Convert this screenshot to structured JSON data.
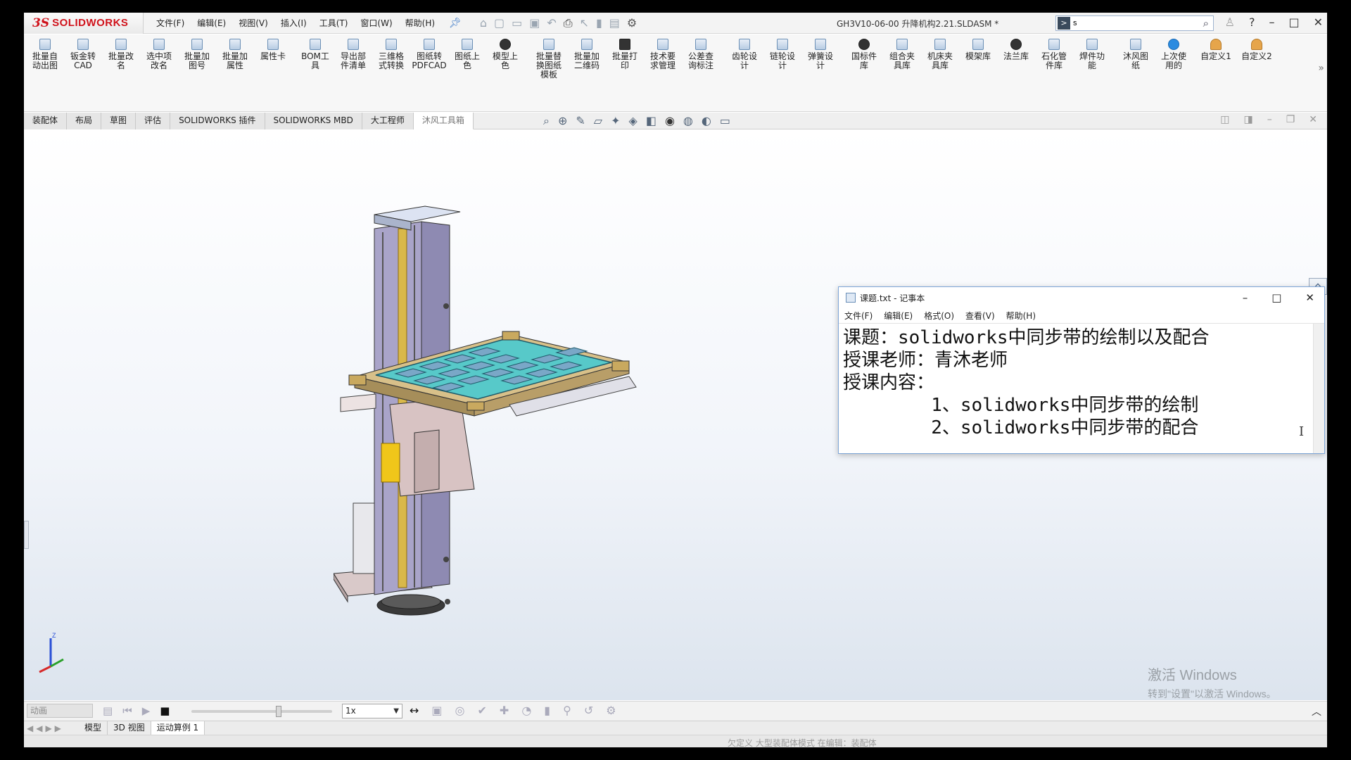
{
  "app": {
    "logo_ds": "3S",
    "logo_text": "SOLIDWORKS",
    "menu": [
      "文件(F)",
      "编辑(E)",
      "视图(V)",
      "插入(I)",
      "工具(T)",
      "窗口(W)",
      "帮助(H)"
    ],
    "document_title": "GH3V10-06-00 升降机构2.21.SLDASM *",
    "search_value": "s"
  },
  "toolbar": {
    "items": [
      {
        "label": "批量自\n动出图",
        "icon": "batch-drawing-icon"
      },
      {
        "label": "钣金转\nCAD",
        "icon": "sheetmetal-cad-icon"
      },
      {
        "label": "批量改\n名",
        "icon": "batch-rename-icon"
      },
      {
        "label": "选中项\n改名",
        "icon": "rename-selected-icon"
      },
      {
        "label": "批量加\n图号",
        "icon": "batch-number-icon"
      },
      {
        "label": "批量加\n属性",
        "icon": "batch-property-icon"
      },
      {
        "label": "属性卡",
        "icon": "property-card-icon"
      },
      {
        "label": "BOM工\n具",
        "icon": "bom-icon"
      },
      {
        "label": "导出部\n件清单",
        "icon": "export-list-icon"
      },
      {
        "label": "三维格\n式转换",
        "icon": "3d-convert-icon"
      },
      {
        "label": "图纸转\nPDFCAD",
        "icon": "drawing-pdf-icon"
      },
      {
        "label": "图纸上\n色",
        "icon": "drawing-color-icon"
      },
      {
        "label": "模型上\n色",
        "icon": "model-color-icon"
      },
      {
        "label": "批量替\n换图纸\n模板",
        "icon": "replace-template-icon"
      },
      {
        "label": "批量加\n二维码",
        "icon": "qrcode-icon"
      },
      {
        "label": "批量打\n印",
        "icon": "print-icon"
      },
      {
        "label": "技术要\n求管理",
        "icon": "tech-req-icon"
      },
      {
        "label": "公差查\n询标注",
        "icon": "tolerance-icon"
      },
      {
        "label": "齿轮设\n计",
        "icon": "gear-design-icon"
      },
      {
        "label": "链轮设\n计",
        "icon": "sprocket-icon"
      },
      {
        "label": "弹簧设\n计",
        "icon": "spring-icon"
      },
      {
        "label": "国标件\n库",
        "icon": "standard-parts-icon"
      },
      {
        "label": "组合夹\n具库",
        "icon": "fixture-icon"
      },
      {
        "label": "机床夹\n具库",
        "icon": "machine-fixture-icon"
      },
      {
        "label": "模架库",
        "icon": "mold-base-icon"
      },
      {
        "label": "法兰库",
        "icon": "flange-icon"
      },
      {
        "label": "石化管\n件库",
        "icon": "pipe-icon"
      },
      {
        "label": "焊件功\n能",
        "icon": "weld-icon"
      },
      {
        "label": "沐风图\n纸",
        "icon": "mufeng-drawing-icon"
      },
      {
        "label": "上次使\n用的",
        "icon": "last-used-icon"
      },
      {
        "label": "自定义1",
        "icon": "custom1-icon"
      },
      {
        "label": "自定义2",
        "icon": "custom2-icon"
      }
    ]
  },
  "tabs": [
    "装配体",
    "布局",
    "草图",
    "评估",
    "SOLIDWORKS 插件",
    "SOLIDWORKS MBD",
    "大工程师",
    "沐风工具箱"
  ],
  "active_tab": "沐风工具箱",
  "notepad": {
    "title": "课题.txt - 记事本",
    "menu": [
      "文件(F)",
      "编辑(E)",
      "格式(O)",
      "查看(V)",
      "帮助(H)"
    ],
    "lines": [
      "课题：solidworks中同步带的绘制以及配合",
      "授课老师：青沐老师",
      "授课内容：",
      "        1、solidworks中同步带的绘制",
      "        2、solidworks中同步带的配合"
    ]
  },
  "watermark": {
    "line1": "激活 Windows",
    "line2": "转到\"设置\"以激活 Windows。"
  },
  "motion": {
    "study_type": "动画",
    "speed": "1x"
  },
  "bottom_tabs": [
    "模型",
    "3D 视图",
    "运动算例 1"
  ],
  "status_text": "欠定义   大型装配体模式   在编辑：装配体"
}
